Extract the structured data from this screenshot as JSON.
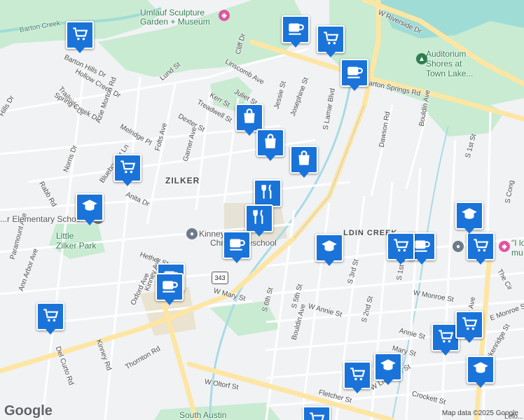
{
  "map": {
    "attribution": "Map data ©2025 Google",
    "logo": "Google",
    "district_label": "ZILKER",
    "poi_labels": {
      "umlauf": "Umlauf Sculpture\nGarden + Museum",
      "auditorium": "Auditorium\nShores at\nTown Lake...",
      "kinney": "Kinney ...",
      "christ": "Christ...Preschool",
      "little_zilker": "Little\nZilker Park",
      "elementary": "...r Elementary School",
      "south_austin": "South Austin",
      "i_love": "\"I lo\nmu",
      "bouldin_creek": "...LDIN CREEK"
    },
    "streets": [
      "Barton Creek",
      "Barton Hills Dr",
      "Hollow Creek Dr",
      "Trailside Dr",
      "Spring Creek Dr",
      "Hills Dr",
      "Lund St",
      "Azie Morton Rd",
      "Melridge Pl",
      "Folts Ave",
      "Dexter St",
      "Garner Ave",
      "Treadwell St",
      "Kerr St",
      "Linscomb Ave",
      "Juliet St",
      "Cliff Dr",
      "S Lamar Blvd",
      "W Riverside Dr",
      "Barton Springs Rd",
      "Dawson Rd",
      "Bouldin Ave",
      "S 1st St",
      "S Cong",
      "Norris Dr",
      "Rabb Rd",
      "Bluebonnet Ln",
      "Anita Dr",
      "Paramount Ave",
      "Ann Arbor Ave",
      "Hether St",
      "Oxford Ave",
      "Kinney Rd",
      "Del Curto Rd",
      "Thornton Rd",
      "W Oltorf St",
      "W Mary St",
      "W Annie St",
      "W Monroe St",
      "S 6th St",
      "S 5th St",
      "S 3rd St",
      "S 2nd St",
      "Fletcher St",
      "W Live Oak St",
      "Crockett St",
      "Brackenridge St",
      "Congress Ave",
      "E Monroe St",
      "The Cir",
      "Jessie St",
      "Josephine St",
      "Kinney Ave",
      "Elmhurst",
      "Lelo...",
      "Annie St",
      "Mary St",
      "S 5th St",
      "S 3rd St",
      "Bouldin Ave",
      "S 1st St"
    ],
    "route_shield": "343",
    "markers": [
      {
        "type": "grocery",
        "name": "grocery-marker"
      },
      {
        "type": "coffee",
        "name": "coffee-marker"
      },
      {
        "type": "grocery",
        "name": "grocery-marker"
      },
      {
        "type": "coffee",
        "name": "coffee-marker"
      },
      {
        "type": "shopping",
        "name": "shopping-marker"
      },
      {
        "type": "shopping",
        "name": "shopping-marker"
      },
      {
        "type": "shopping",
        "name": "shopping-marker"
      },
      {
        "type": "restaurant",
        "name": "restaurant-marker"
      },
      {
        "type": "restaurant",
        "name": "restaurant-marker"
      },
      {
        "type": "coffee",
        "name": "coffee-marker"
      },
      {
        "type": "grocery",
        "name": "grocery-marker"
      },
      {
        "type": "school",
        "name": "school-marker"
      },
      {
        "type": "coffee",
        "name": "coffee-marker"
      },
      {
        "type": "grocery",
        "name": "grocery-marker"
      },
      {
        "type": "grocery",
        "name": "grocery-marker"
      },
      {
        "type": "school",
        "name": "school-marker"
      },
      {
        "type": "coffee",
        "name": "coffee-marker"
      },
      {
        "type": "coffee",
        "name": "coffee-marker"
      },
      {
        "type": "school",
        "name": "school-marker"
      },
      {
        "type": "grocery",
        "name": "grocery-marker"
      },
      {
        "type": "grocery",
        "name": "grocery-marker"
      },
      {
        "type": "grocery",
        "name": "grocery-marker"
      },
      {
        "type": "school",
        "name": "school-marker"
      },
      {
        "type": "grocery",
        "name": "grocery-marker"
      },
      {
        "type": "school",
        "name": "school-marker"
      },
      {
        "type": "grocery",
        "name": "grocery-marker"
      }
    ],
    "colors": {
      "marker": "#1a73d9",
      "park": "#c8ebd2",
      "water": "#9fdcd6",
      "land": "#f1f2f4",
      "road": "#ffffff",
      "highway": "#fde6a4"
    }
  }
}
